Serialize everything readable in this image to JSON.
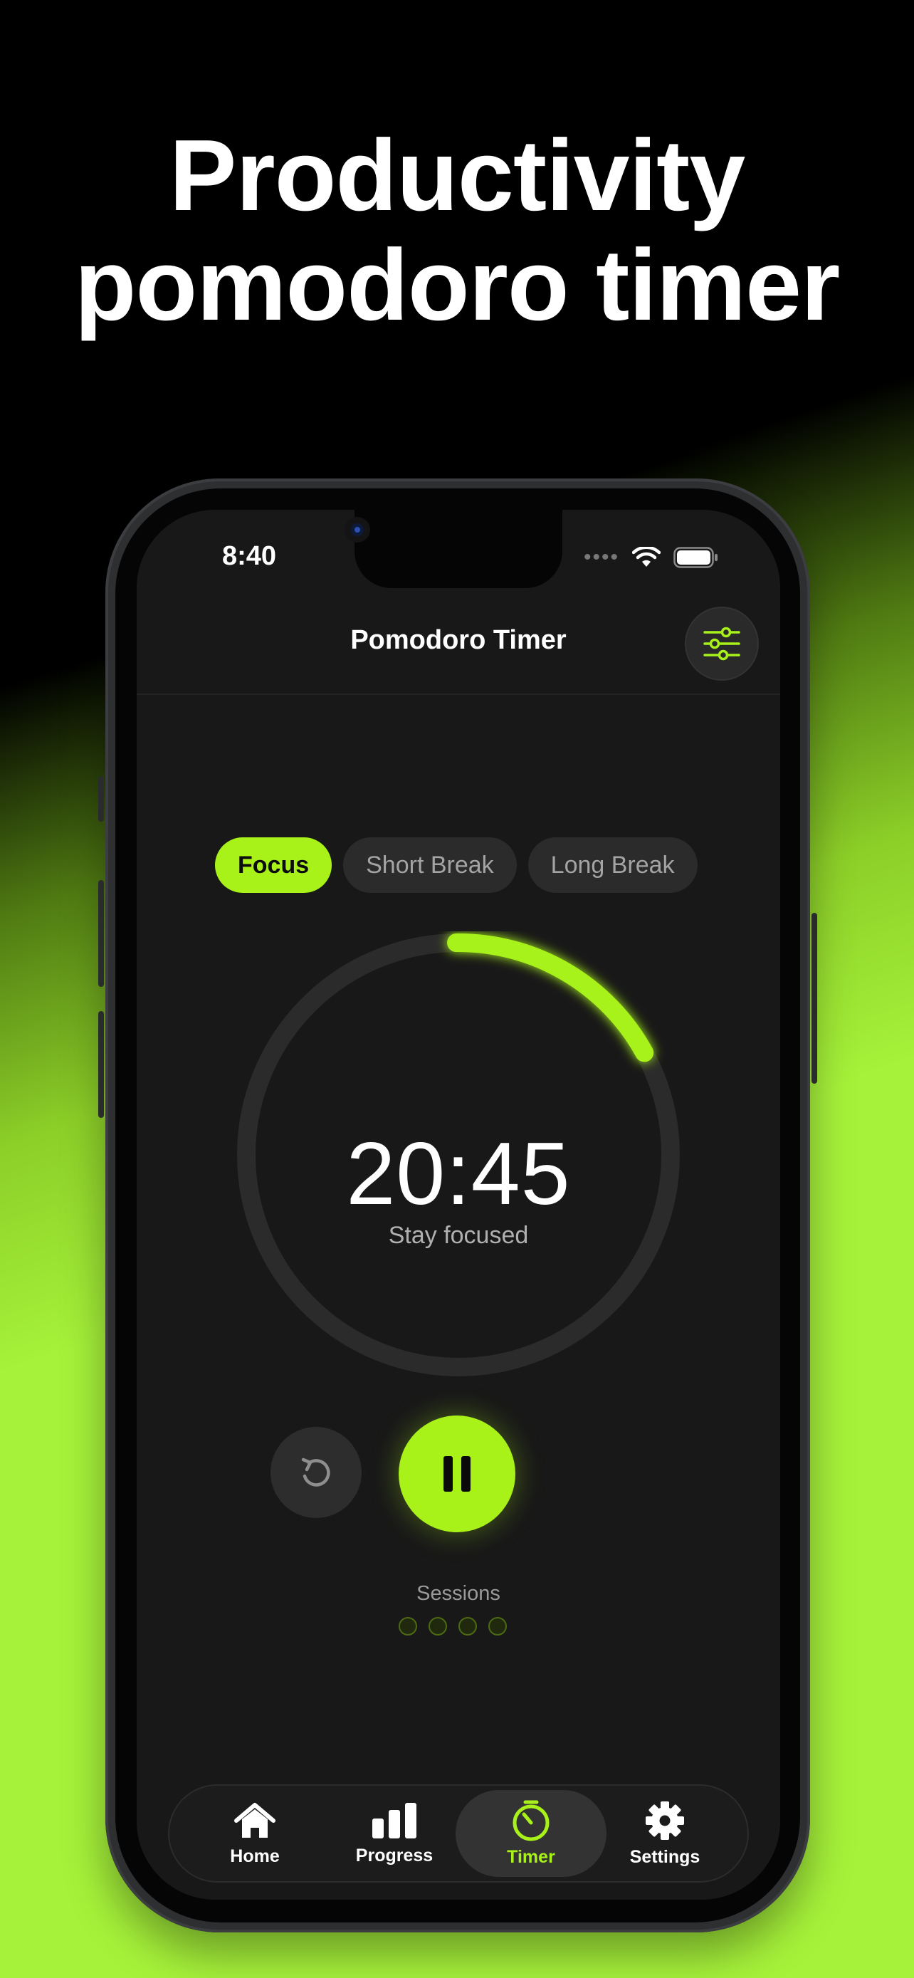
{
  "headline": {
    "line1": "Productivity",
    "line2": "pomodoro timer"
  },
  "status_bar": {
    "time": "8:40",
    "signal": "••••"
  },
  "header": {
    "title": "Pomodoro Timer"
  },
  "modes": [
    {
      "label": "Focus",
      "active": true
    },
    {
      "label": "Short Break",
      "active": false
    },
    {
      "label": "Long Break",
      "active": false
    }
  ],
  "timer": {
    "time": "20:45",
    "subtitle": "Stay focused",
    "progress": 0.17
  },
  "sessions": {
    "label": "Sessions",
    "total": 4,
    "completed": 0
  },
  "tabs": [
    {
      "label": "Home",
      "icon": "home-icon",
      "active": false
    },
    {
      "label": "Progress",
      "icon": "bar-chart-icon",
      "active": false
    },
    {
      "label": "Timer",
      "icon": "timer-icon",
      "active": true
    },
    {
      "label": "Settings",
      "icon": "gear-icon",
      "active": false
    }
  ],
  "colors": {
    "accent": "#a8f21a",
    "screen_bg": "#181818",
    "ring_track": "#2b2b2b"
  }
}
